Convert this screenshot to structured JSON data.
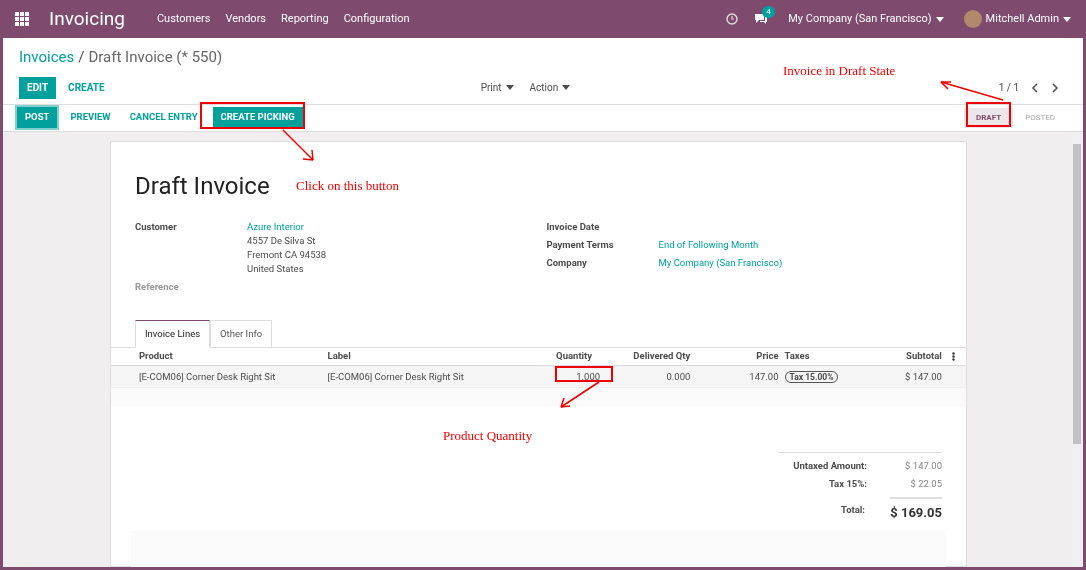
{
  "navbar": {
    "app": "Invoicing",
    "menu": [
      "Customers",
      "Vendors",
      "Reporting",
      "Configuration"
    ],
    "chat_count": "4",
    "company": "My Company (San Francisco)",
    "user": "Mitchell Admin"
  },
  "breadcrumb": {
    "parent": "Invoices",
    "separator": "/",
    "current": "Draft Invoice (* 550)"
  },
  "control_buttons": {
    "primary": "EDIT",
    "secondary": "CREATE",
    "dropdowns": [
      "Print",
      "Action"
    ],
    "pager": "1 / 1"
  },
  "status_actions": [
    {
      "label": "POST",
      "kind": "primary"
    },
    {
      "label": "PREVIEW",
      "kind": "link"
    },
    {
      "label": "CANCEL ENTRY",
      "kind": "link"
    },
    {
      "label": "CREATE PICKING",
      "kind": "solid"
    }
  ],
  "status_steps": [
    {
      "label": "DRAFT",
      "selected": true
    },
    {
      "label": "POSTED",
      "selected": false
    }
  ],
  "sheet": {
    "title": "Draft Invoice",
    "left_fields": [
      {
        "label": "Customer",
        "lines": [
          "Azure Interior",
          "4557 De Silva St",
          "Fremont CA 94538",
          "United States"
        ]
      },
      {
        "label": "Reference"
      }
    ],
    "right_fields": [
      {
        "label": "Invoice Date"
      },
      {
        "label": "Payment Terms",
        "value": "End of Following Month"
      },
      {
        "label": "Company",
        "value": "My Company (San Francisco)"
      }
    ],
    "tabs": [
      {
        "label": "Invoice Lines",
        "selected": true
      },
      {
        "label": "Other Info",
        "selected": false
      }
    ],
    "columns": [
      "Product",
      "Label",
      "Quantity",
      "Delivered Qty",
      "Price",
      "Taxes",
      "Subtotal"
    ],
    "rows": [
      {
        "product": "[E-COM06] Corner Desk Right Sit",
        "label": "[E-COM06] Corner Desk Right Sit",
        "quantity": "1.000",
        "delivered": "0.000",
        "price": "147.00",
        "tax": "Tax 15.00%",
        "subtotal": "$ 147.00"
      }
    ],
    "totals": [
      {
        "label": "Untaxed Amount:",
        "value": "$ 147.00",
        "kind": "line"
      },
      {
        "label": "Tax 15%:",
        "value": "$ 22.05",
        "kind": "line"
      },
      {
        "label": "Total:",
        "value": "$ 169.05",
        "kind": "grand"
      }
    ]
  },
  "annotations": [
    "Invoice in Draft State",
    "Click on this button",
    "Product Quantity"
  ]
}
